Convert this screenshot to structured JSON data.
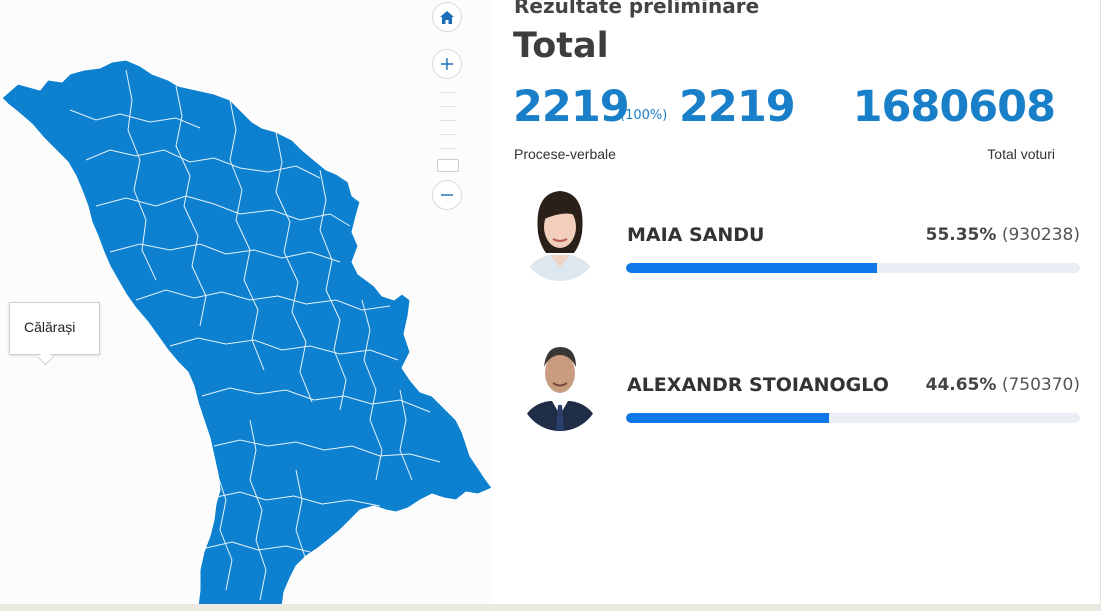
{
  "map": {
    "tooltip_label": "Călărași",
    "region_color": "#0d80cf",
    "controls": [
      "home-icon",
      "zoom-in-icon",
      "zoom-out-icon"
    ]
  },
  "results": {
    "subtitle": "Rezultate preliminare",
    "title": "Total",
    "pv_counted": "2219",
    "pv_percent": "(100%)",
    "pv_total": "2219",
    "pv_caption": "Procese-verbale",
    "total_votes": "1680608",
    "total_votes_caption": "Total voturi",
    "accent_color": "#1a7fc9"
  },
  "candidates": [
    {
      "name": "MAIA SANDU",
      "percent": "55.35%",
      "votes": "(930238)",
      "share": 0.5535
    },
    {
      "name": "ALEXANDR STOIANOGLO",
      "percent": "44.65%",
      "votes": "(750370)",
      "share": 0.4465
    }
  ]
}
